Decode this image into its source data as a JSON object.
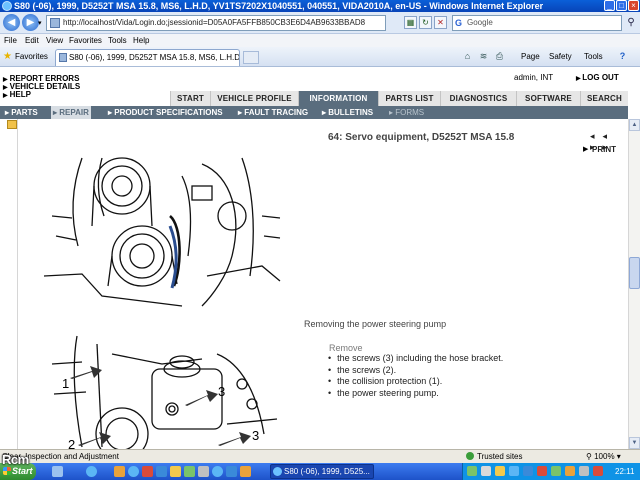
{
  "window": {
    "title": "S80 (-06), 1999, D5252T MSA 15.8, MS6, L.H.D, YV1TS7202X1040551, 040551, VIDA2010A, en-US - Windows Internet Explorer"
  },
  "address": {
    "url": "http://localhost/Vida/Login.do;jsessionid=D05A0FA5FFB850CB3E6D4AB9633BBAD8",
    "search_placeholder": "Google"
  },
  "menu": [
    "File",
    "Edit",
    "View",
    "Favorites",
    "Tools",
    "Help"
  ],
  "favorites_bar": {
    "favorites_label": "Favorites",
    "tab_title": "S80 (-06), 1999, D5252T MSA 15.8, MS6, L.H.D, YV1...",
    "commands": {
      "page": "Page",
      "safety": "Safety",
      "tools": "Tools"
    }
  },
  "vida": {
    "left_links": [
      "REPORT ERRORS",
      "VEHICLE DETAILS",
      "HELP"
    ],
    "user": "admin, INT",
    "logout": "LOG OUT",
    "main_tabs": [
      "START",
      "VEHICLE PROFILE",
      "INFORMATION",
      "PARTS LIST",
      "DIAGNOSTICS",
      "SOFTWARE",
      "SEARCH"
    ],
    "active_main_tab": "INFORMATION",
    "sub_nav": [
      "PARTS",
      "REPAIR",
      "PRODUCT SPECIFICATIONS",
      "FAULT TRACING",
      "BULLETINS",
      "FORMS"
    ],
    "active_sub_nav": "REPAIR"
  },
  "document": {
    "title": "64: Servo equipment, D5252T MSA 15.8",
    "prev_next": "◂◂ ▸▸",
    "print_label": "PRINT",
    "section_heading": "Removing the power steering pump",
    "remove_label": "Remove",
    "steps": [
      "the screws (3) including the hose bracket.",
      "the screws (2).",
      "the collision protection (1).",
      "the power steering pump."
    ],
    "figure_callouts": [
      "1",
      "2",
      "3",
      "3"
    ]
  },
  "status_bar": {
    "text": "Clear, Inspection and Adjustment",
    "zone": "Trusted sites",
    "zoom": "100%"
  },
  "taskbar": {
    "start_label": "Start",
    "task_item": "S80 (-06), 1999, D525...",
    "clock": "22:11"
  },
  "overlay": {
    "watermark": "Rcm"
  }
}
